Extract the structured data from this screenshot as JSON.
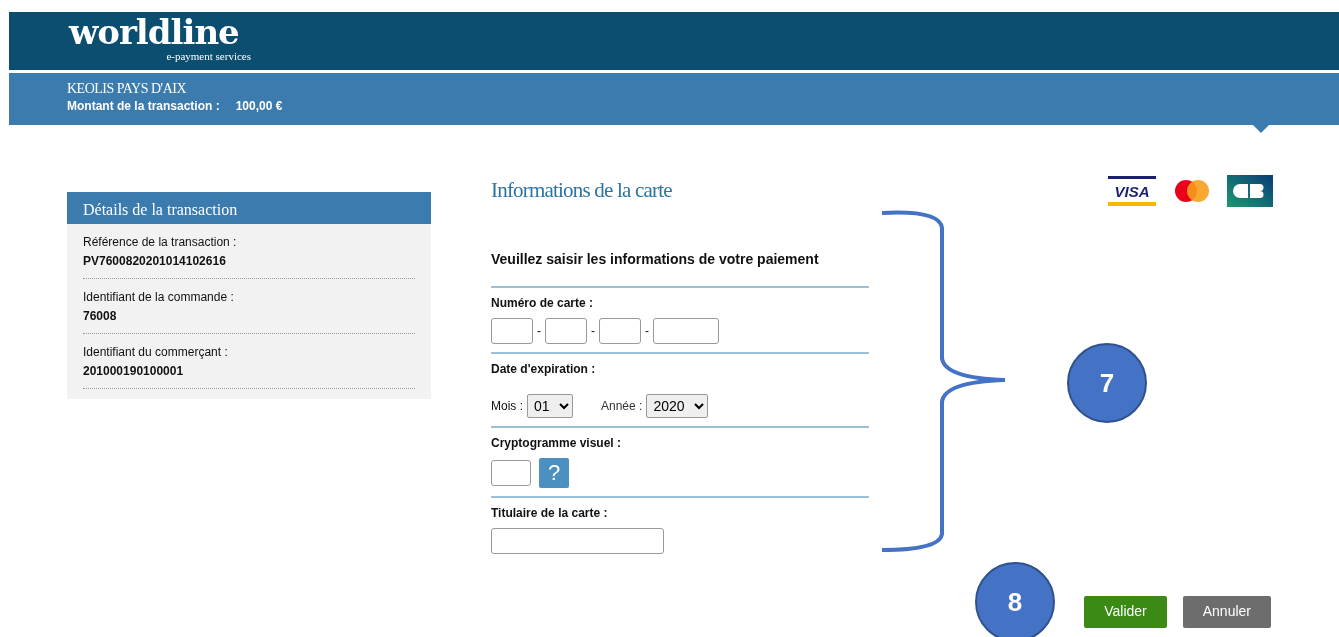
{
  "header": {
    "logo": "worldline",
    "logo_tagline": "e-payment services"
  },
  "merchant_band": {
    "merchant": "KEOLIS PAYS D'AIX",
    "amount_label": "Montant de la transaction :",
    "amount": "100,00 €"
  },
  "details": {
    "title": "Détails de la transaction",
    "items": [
      {
        "label": "Référence de la transaction :",
        "value": "PV7600820201014102616"
      },
      {
        "label": "Identifiant de la commande :",
        "value": "76008"
      },
      {
        "label": "Identifiant du commerçant :",
        "value": "201000190100001"
      }
    ]
  },
  "card_form": {
    "title": "Informations de la carte",
    "instruction": "Veuillez saisir les informations de votre paiement",
    "card_number": {
      "label": "Numéro de carte :",
      "separators": [
        "-",
        "-",
        "-"
      ]
    },
    "expiry": {
      "label": "Date d'expiration :",
      "month_label": "Mois :",
      "month": "01",
      "year_label": "Année :",
      "year": "2020"
    },
    "cvv": {
      "label": "Cryptogramme visuel :",
      "help": "?"
    },
    "holder": {
      "label": "Titulaire de la carte :"
    }
  },
  "card_brands": [
    {
      "kind": "visa",
      "text": "VISA"
    },
    {
      "kind": "mastercard"
    },
    {
      "kind": "cb"
    }
  ],
  "annotations": [
    {
      "kind": "brace",
      "number": "7"
    },
    {
      "kind": "circle",
      "number": "8"
    }
  ],
  "buttons": [
    {
      "kind": "submit",
      "label": "Valider"
    },
    {
      "kind": "cancel",
      "label": "Annuler"
    }
  ]
}
